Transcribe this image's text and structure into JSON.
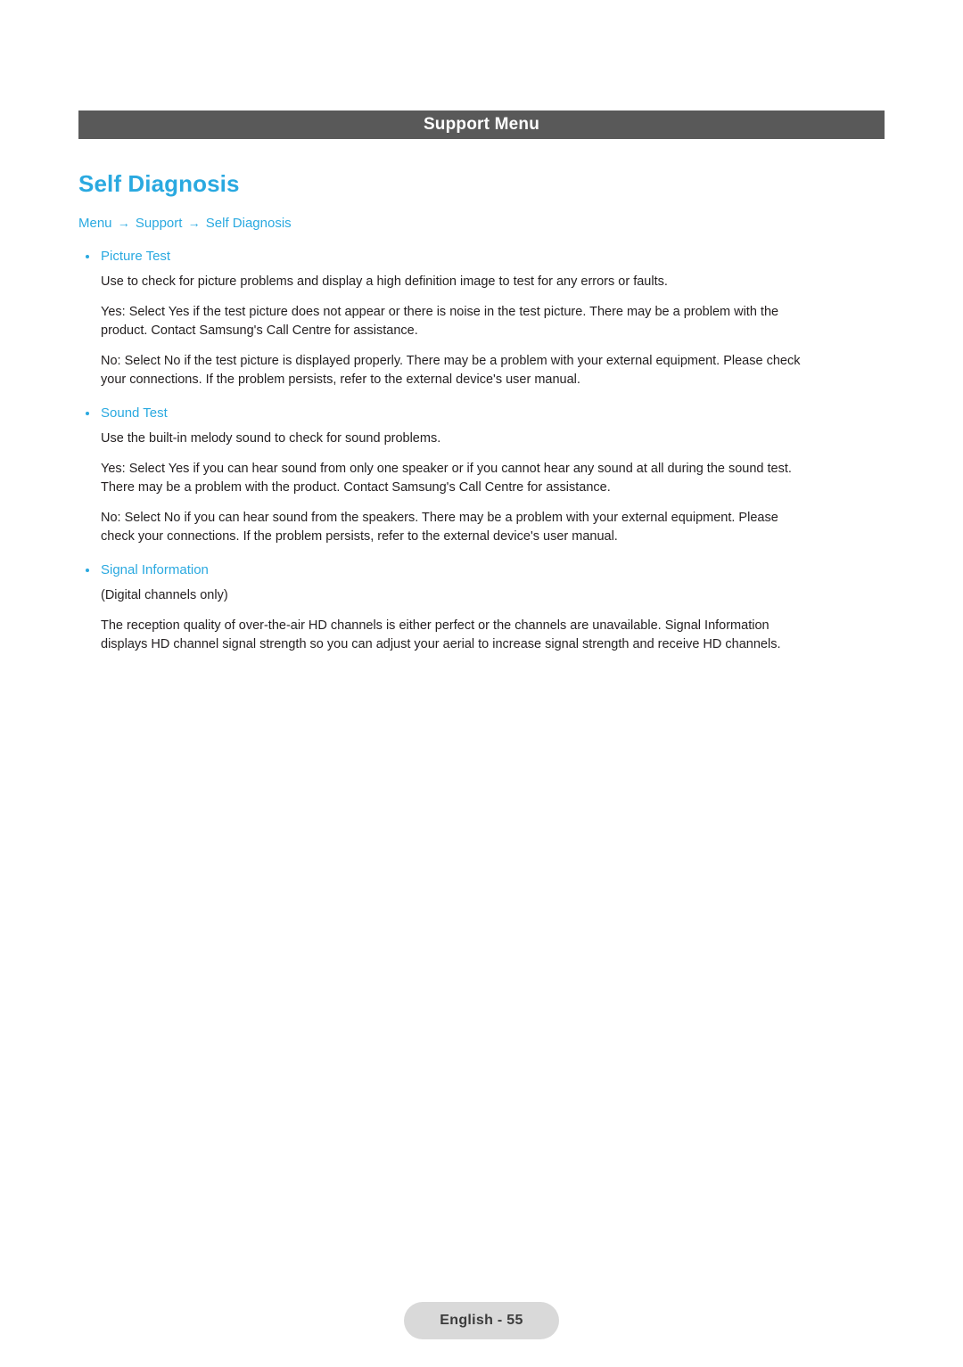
{
  "header": {
    "title": "Support Menu"
  },
  "heading": "Self Diagnosis",
  "menu_path": {
    "items": [
      "Menu",
      "Support",
      "Self Diagnosis"
    ],
    "separator": "→"
  },
  "sections": [
    {
      "title": "Picture Test",
      "paragraphs": [
        "Use to check for picture problems and display a high definition image to test for any errors or faults.",
        "Yes: Select Yes if the test picture does not appear or there is noise in the test picture. There may be a problem with the product. Contact Samsung's Call Centre for assistance.",
        "No: Select No if the test picture is displayed properly. There may be a problem with your external equipment. Please check your connections. If the problem persists, refer to the external device's user manual."
      ]
    },
    {
      "title": "Sound Test",
      "paragraphs": [
        "Use the built-in melody sound to check for sound problems.",
        "Yes: Select Yes if you can hear sound from only one speaker or if you cannot hear any sound at all during the sound test. There may be a problem with the product. Contact Samsung's Call Centre for assistance.",
        "No: Select No if you can hear sound from the speakers. There may be a problem with your external equipment. Please check your connections. If the problem persists, refer to the external device's user manual."
      ]
    },
    {
      "title": "Signal Information",
      "paragraphs": [
        "(Digital channels only)",
        "The reception quality of over-the-air HD channels is either perfect or the channels are unavailable. Signal Information displays HD channel signal strength so you can adjust your aerial to increase signal strength and receive HD channels."
      ]
    }
  ],
  "footer": {
    "page_label": "English - 55"
  }
}
